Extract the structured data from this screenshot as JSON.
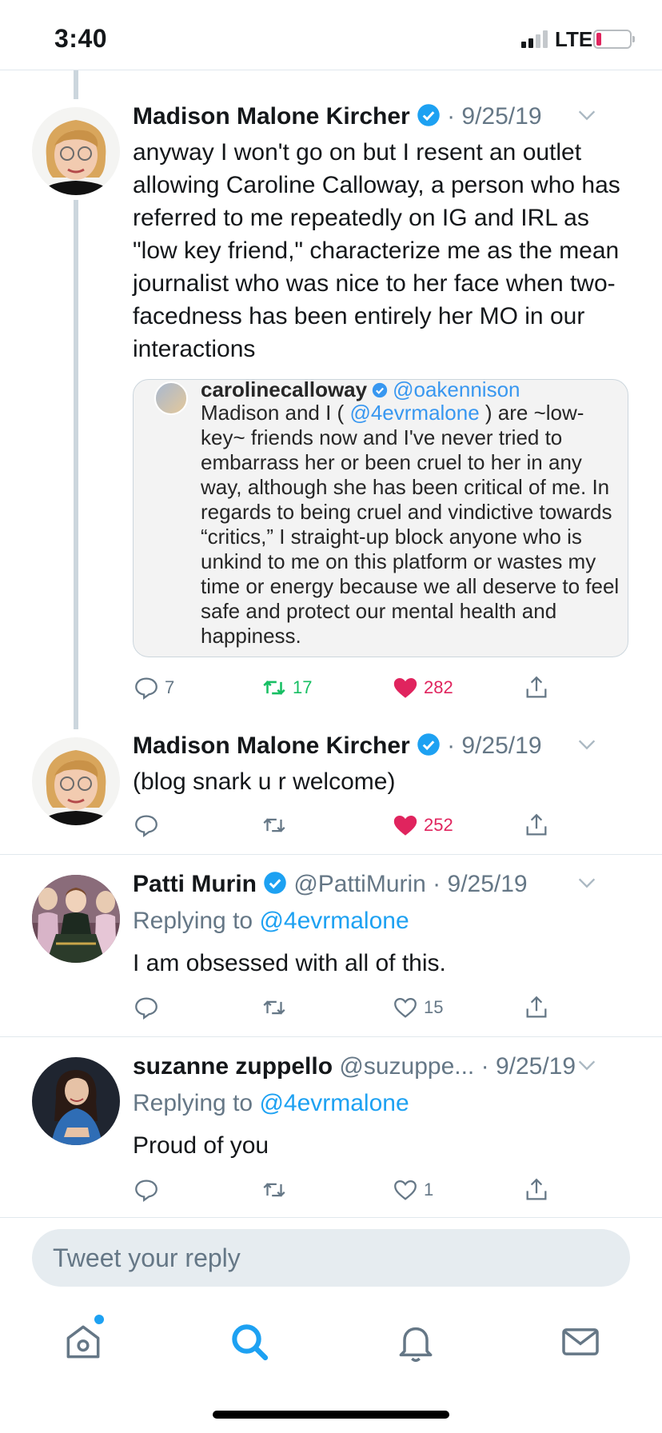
{
  "status_bar": {
    "time": "3:40",
    "network": "LTE",
    "battery_color": "#e0245e"
  },
  "tweets": [
    {
      "author": "Madison Malone Kircher",
      "verified": true,
      "date": "9/25/19",
      "text": "anyway I won't go on but I resent an outlet allowing Caroline Calloway, a person who has referred to me repeatedly on IG and IRL as \"low key friend,\" characterize me as the mean journalist who was nice to her face when two-facedness has been entirely her MO in our interactions",
      "embed": {
        "username": "carolinecalloway",
        "handle": "@oakennison",
        "text_before": "Madison and I ( ",
        "mention": "@4evrmalone",
        "text_after": " ) are ~low-key~ friends now and I've never tried to embarrass her or been cruel to her in any way, although she has been critical of me. In regards to being cruel and vindictive towards “critics,” I straight-up block anyone who is unkind to me on this platform or wastes my time or energy because we all deserve to feel safe and protect our mental health and happiness."
      },
      "replies": "7",
      "retweets": "17",
      "likes": "282"
    },
    {
      "author": "Madison Malone Kircher",
      "verified": true,
      "date": "9/25/19",
      "text": "(blog snark u r welcome)",
      "replies": "",
      "retweets": "",
      "likes": "252"
    },
    {
      "author": "Patti Murin",
      "verified": true,
      "handle": "@PattiMurin",
      "date": "9/25/19",
      "replying_prefix": "Replying to ",
      "replying_to": "@4evrmalone",
      "text": "I am obsessed with all of this.",
      "replies": "",
      "retweets": "",
      "likes": "15"
    },
    {
      "author": "suzanne zuppello",
      "verified": false,
      "handle": "@suzuppe...",
      "date": "9/25/19",
      "replying_prefix": "Replying to ",
      "replying_to": "@4evrmalone",
      "text": "Proud of you",
      "replies": "",
      "retweets": "",
      "likes": "1"
    }
  ],
  "composer": {
    "placeholder": "Tweet your reply"
  },
  "nav": {
    "items": [
      "home-icon",
      "search-icon",
      "notifications-icon",
      "messages-icon"
    ],
    "active": "search-icon",
    "accent": "#1da1f2"
  },
  "separator": " · "
}
